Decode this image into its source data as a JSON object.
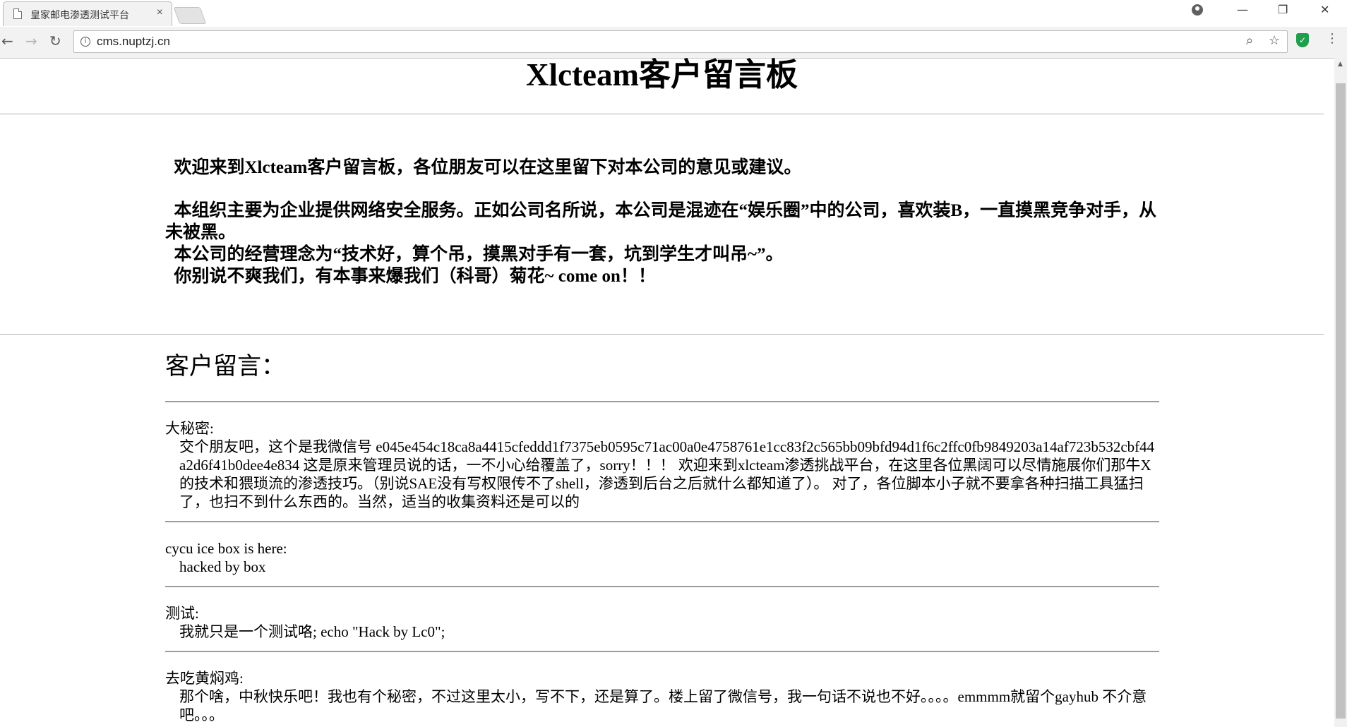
{
  "browser": {
    "tab_title": "皇家邮电渗透测试平台",
    "tab_close": "×",
    "url": "cms.nuptzj.cn",
    "window_controls": {
      "minimize": "—",
      "restore": "❐",
      "close": "✕"
    }
  },
  "page": {
    "title": "Xlcteam客户留言板",
    "intro": {
      "welcome": "欢迎来到Xlcteam客户留言板，各位朋友可以在这里留下对本公司的意见或建议。",
      "paragraph1": "本组织主要为企业提供网络安全服务。正如公司名所说，本公司是混迹在“娱乐圈”中的公司，喜欢装B，一直摸黑竞争对手，从未被黑。",
      "paragraph2": "本公司的经营理念为“技术好，算个吊，摸黑对手有一套，坑到学生才叫吊~”。",
      "paragraph3": "你别说不爽我们，有本事来爆我们（科哥）菊花~ come on！！"
    },
    "messages_heading": "客户留言：",
    "messages": [
      {
        "author": "大秘密:",
        "content": "交个朋友吧，这个是我微信号 e045e454c18ca8a4415cfeddd1f7375eb0595c71ac00a0e4758761e1cc83f2c565bb09bfd94d1f6c2ffc0fb9849203a14af723b532cbf44a2d6f41b0dee4e834 这是原来管理员说的话，一不小心给覆盖了，sorry！！！ 欢迎来到xlcteam渗透挑战平台，在这里各位黑阔可以尽情施展你们那牛X的技术和猥琐流的渗透技巧。（别说SAE没有写权限传不了shell，渗透到后台之后就什么都知道了）。 对了，各位脚本小子就不要拿各种扫描工具猛扫了，也扫不到什么东西的。当然，适当的收集资料还是可以的"
      },
      {
        "author": "cycu ice box is here:",
        "content": "hacked by box"
      },
      {
        "author": "测试:",
        "content": "我就只是一个测试咯; echo \"Hack by Lc0\";"
      },
      {
        "author": "去吃黄焖鸡:",
        "content": "那个啥，中秋快乐吧！我也有个秘密，不过这里太小，写不下，还是算了。楼上留了微信号，我一句话不说也不好。。。。emmmm就留个gayhub 不介意吧。。。"
      }
    ]
  }
}
